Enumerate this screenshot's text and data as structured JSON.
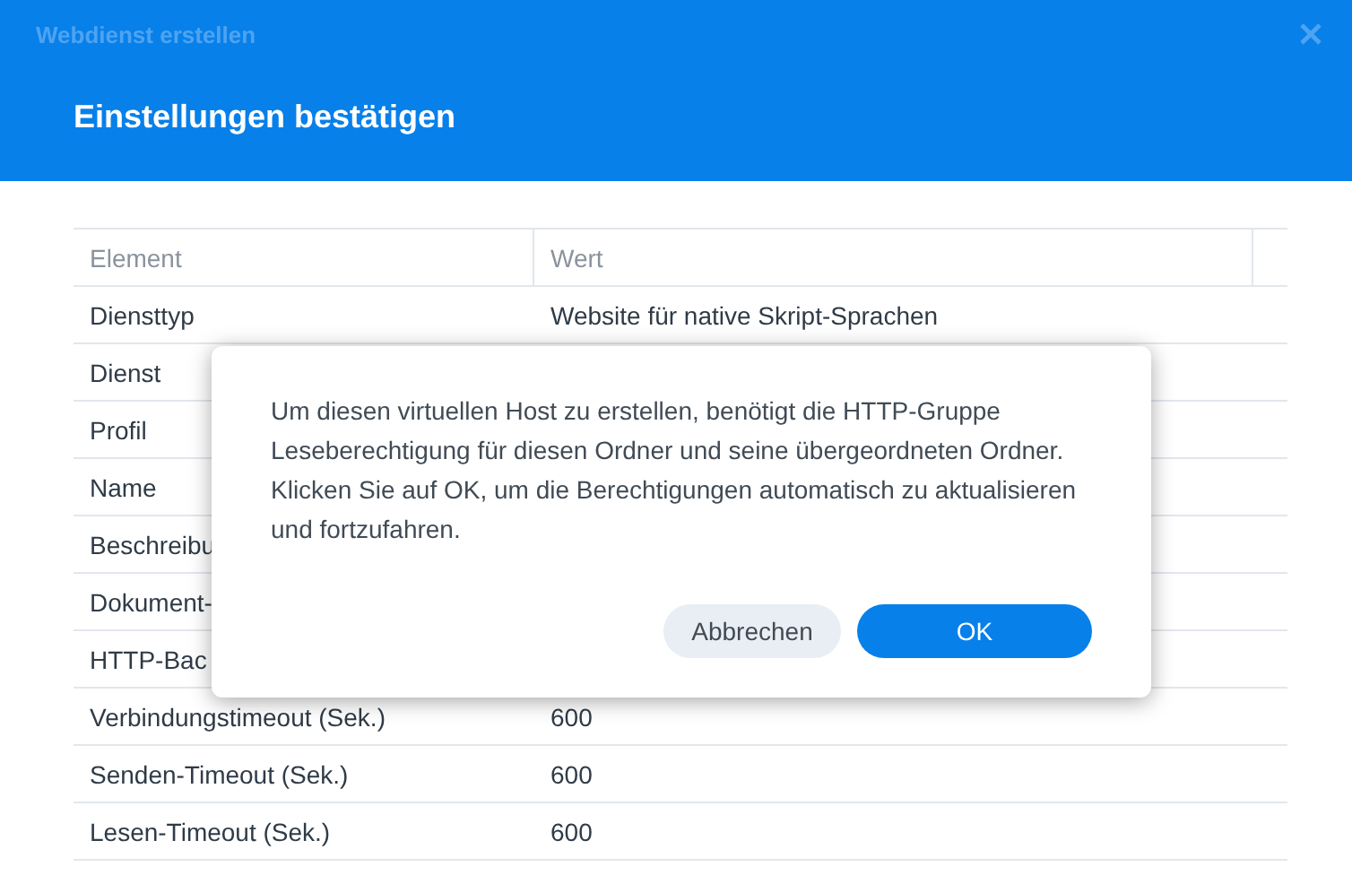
{
  "window": {
    "title": "Webdienst erstellen"
  },
  "header": {
    "title": "Einstellungen bestätigen"
  },
  "table": {
    "columns": [
      "Element",
      "Wert"
    ],
    "rows": [
      {
        "element": "Diensttyp",
        "value": "Website für native Skript-Sprachen"
      },
      {
        "element": "Dienst"
      },
      {
        "element": "Profil"
      },
      {
        "element": "Name"
      },
      {
        "element": "Beschreibu"
      },
      {
        "element": "Dokument-"
      },
      {
        "element": "HTTP-Bac"
      },
      {
        "element": "Verbindungstimeout (Sek.)",
        "value": "600"
      },
      {
        "element": "Senden-Timeout (Sek.)",
        "value": "600"
      },
      {
        "element": "Lesen-Timeout (Sek.)",
        "value": "600"
      }
    ]
  },
  "dialog": {
    "message": "Um diesen virtuellen Host zu erstellen, benötigt die HTTP-Gruppe Leseberechtigung für diesen Ordner und seine übergeordneten Ordner. Klicken Sie auf OK, um die Berechtigungen automatisch zu aktualisieren und fortzufahren.",
    "buttons": [
      {
        "label": "Abbrechen",
        "kind": "secondary"
      },
      {
        "label": "OK",
        "kind": "primary"
      }
    ]
  }
}
